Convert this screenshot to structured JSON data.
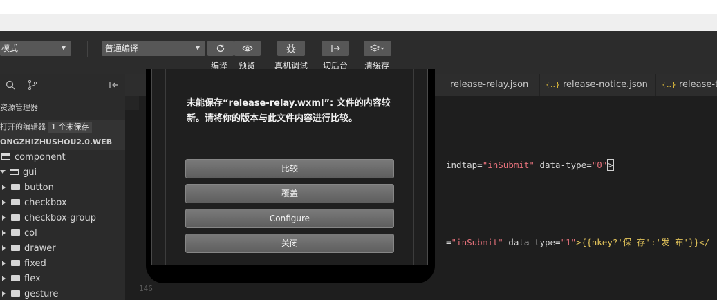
{
  "toolbar": {
    "mode_select": "模式",
    "compile_select": "普通编译",
    "labels": {
      "compile": "编译",
      "preview": "预览",
      "debug": "真机调试",
      "background": "切后台",
      "cache": "清缓存"
    }
  },
  "sidebar": {
    "explorer_title": "资源管理器",
    "open_editors": "打开的编辑器",
    "unsaved_badge": "1 个未保存",
    "project_name": "ONGZHIZHUSHOU2.0.WEB",
    "tree": [
      {
        "label": "component"
      },
      {
        "label": "gui"
      },
      {
        "label": "button"
      },
      {
        "label": "checkbox"
      },
      {
        "label": "checkbox-group"
      },
      {
        "label": "col"
      },
      {
        "label": "drawer"
      },
      {
        "label": "fixed"
      },
      {
        "label": "flex"
      },
      {
        "label": "gesture"
      }
    ]
  },
  "tabs": [
    {
      "label": "release-relay.json",
      "icon": "none"
    },
    {
      "label": "release-notice.json",
      "icon": "{..}"
    },
    {
      "label": "release-ta",
      "icon": "{..}"
    }
  ],
  "code": {
    "line1_a": "indtap=",
    "line1_b": "\"inSubmit\"",
    "line1_c": " data-type=",
    "line1_d": "\"0\"",
    "line2_a": "=",
    "line2_b": "\"inSubmit\"",
    "line2_c": " data-type=",
    "line2_d": "\"1\"",
    "line2_e": ">{{nkey?'保 存':'发 布'}}</",
    "line_numbers": [
      "146"
    ]
  },
  "dialog": {
    "message": "未能保存“release-relay.wxml”: 文件的内容较新。请将你的版本与此文件内容进行比较。",
    "buttons": {
      "compare": "比较",
      "overwrite": "覆盖",
      "configure": "Configure",
      "close": "关闭"
    }
  },
  "colors": {
    "toolbar_bg": "#2c2c2c",
    "editor_bg": "#1e1e1e",
    "string_red": "#e5717b",
    "json_icon": "#e6c23c"
  }
}
